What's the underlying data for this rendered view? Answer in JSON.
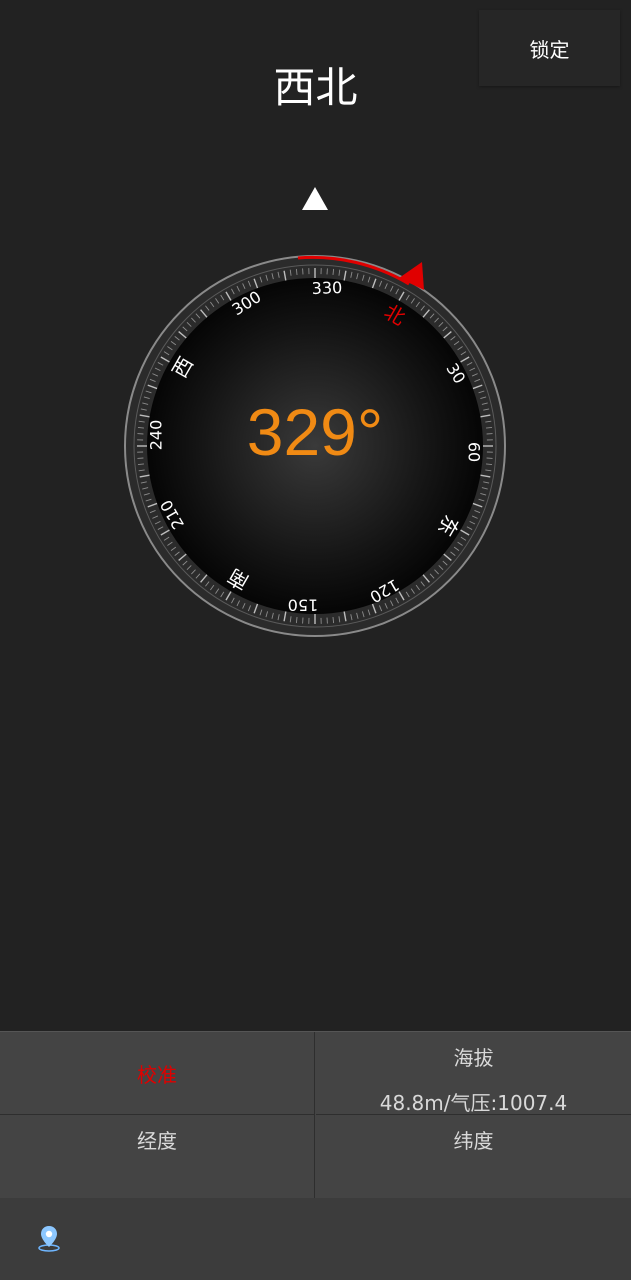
{
  "header": {
    "lock_label": "锁定",
    "direction_name": "西北"
  },
  "compass": {
    "heading": "329°",
    "heading_degrees": 329,
    "cardinal_labels": {
      "north": "北",
      "east": "东",
      "south": "南",
      "west": "西"
    },
    "degree_labels": {
      "d30": "30",
      "d60": "60",
      "d120": "120",
      "d150": "150",
      "d210": "210",
      "d240": "240",
      "d300": "300",
      "d330": "330"
    },
    "colors": {
      "heading_text": "#f08a14",
      "north": "#e00000",
      "indicator_arc": "#e00000"
    }
  },
  "info": {
    "calibrate_label": "校准",
    "altitude_label": "海拔",
    "altitude_value": "48.8m/气压:1007.4",
    "longitude_label": "经度",
    "latitude_label": "纬度"
  },
  "bottom_bar": {
    "location_icon": "location-pin-icon"
  }
}
